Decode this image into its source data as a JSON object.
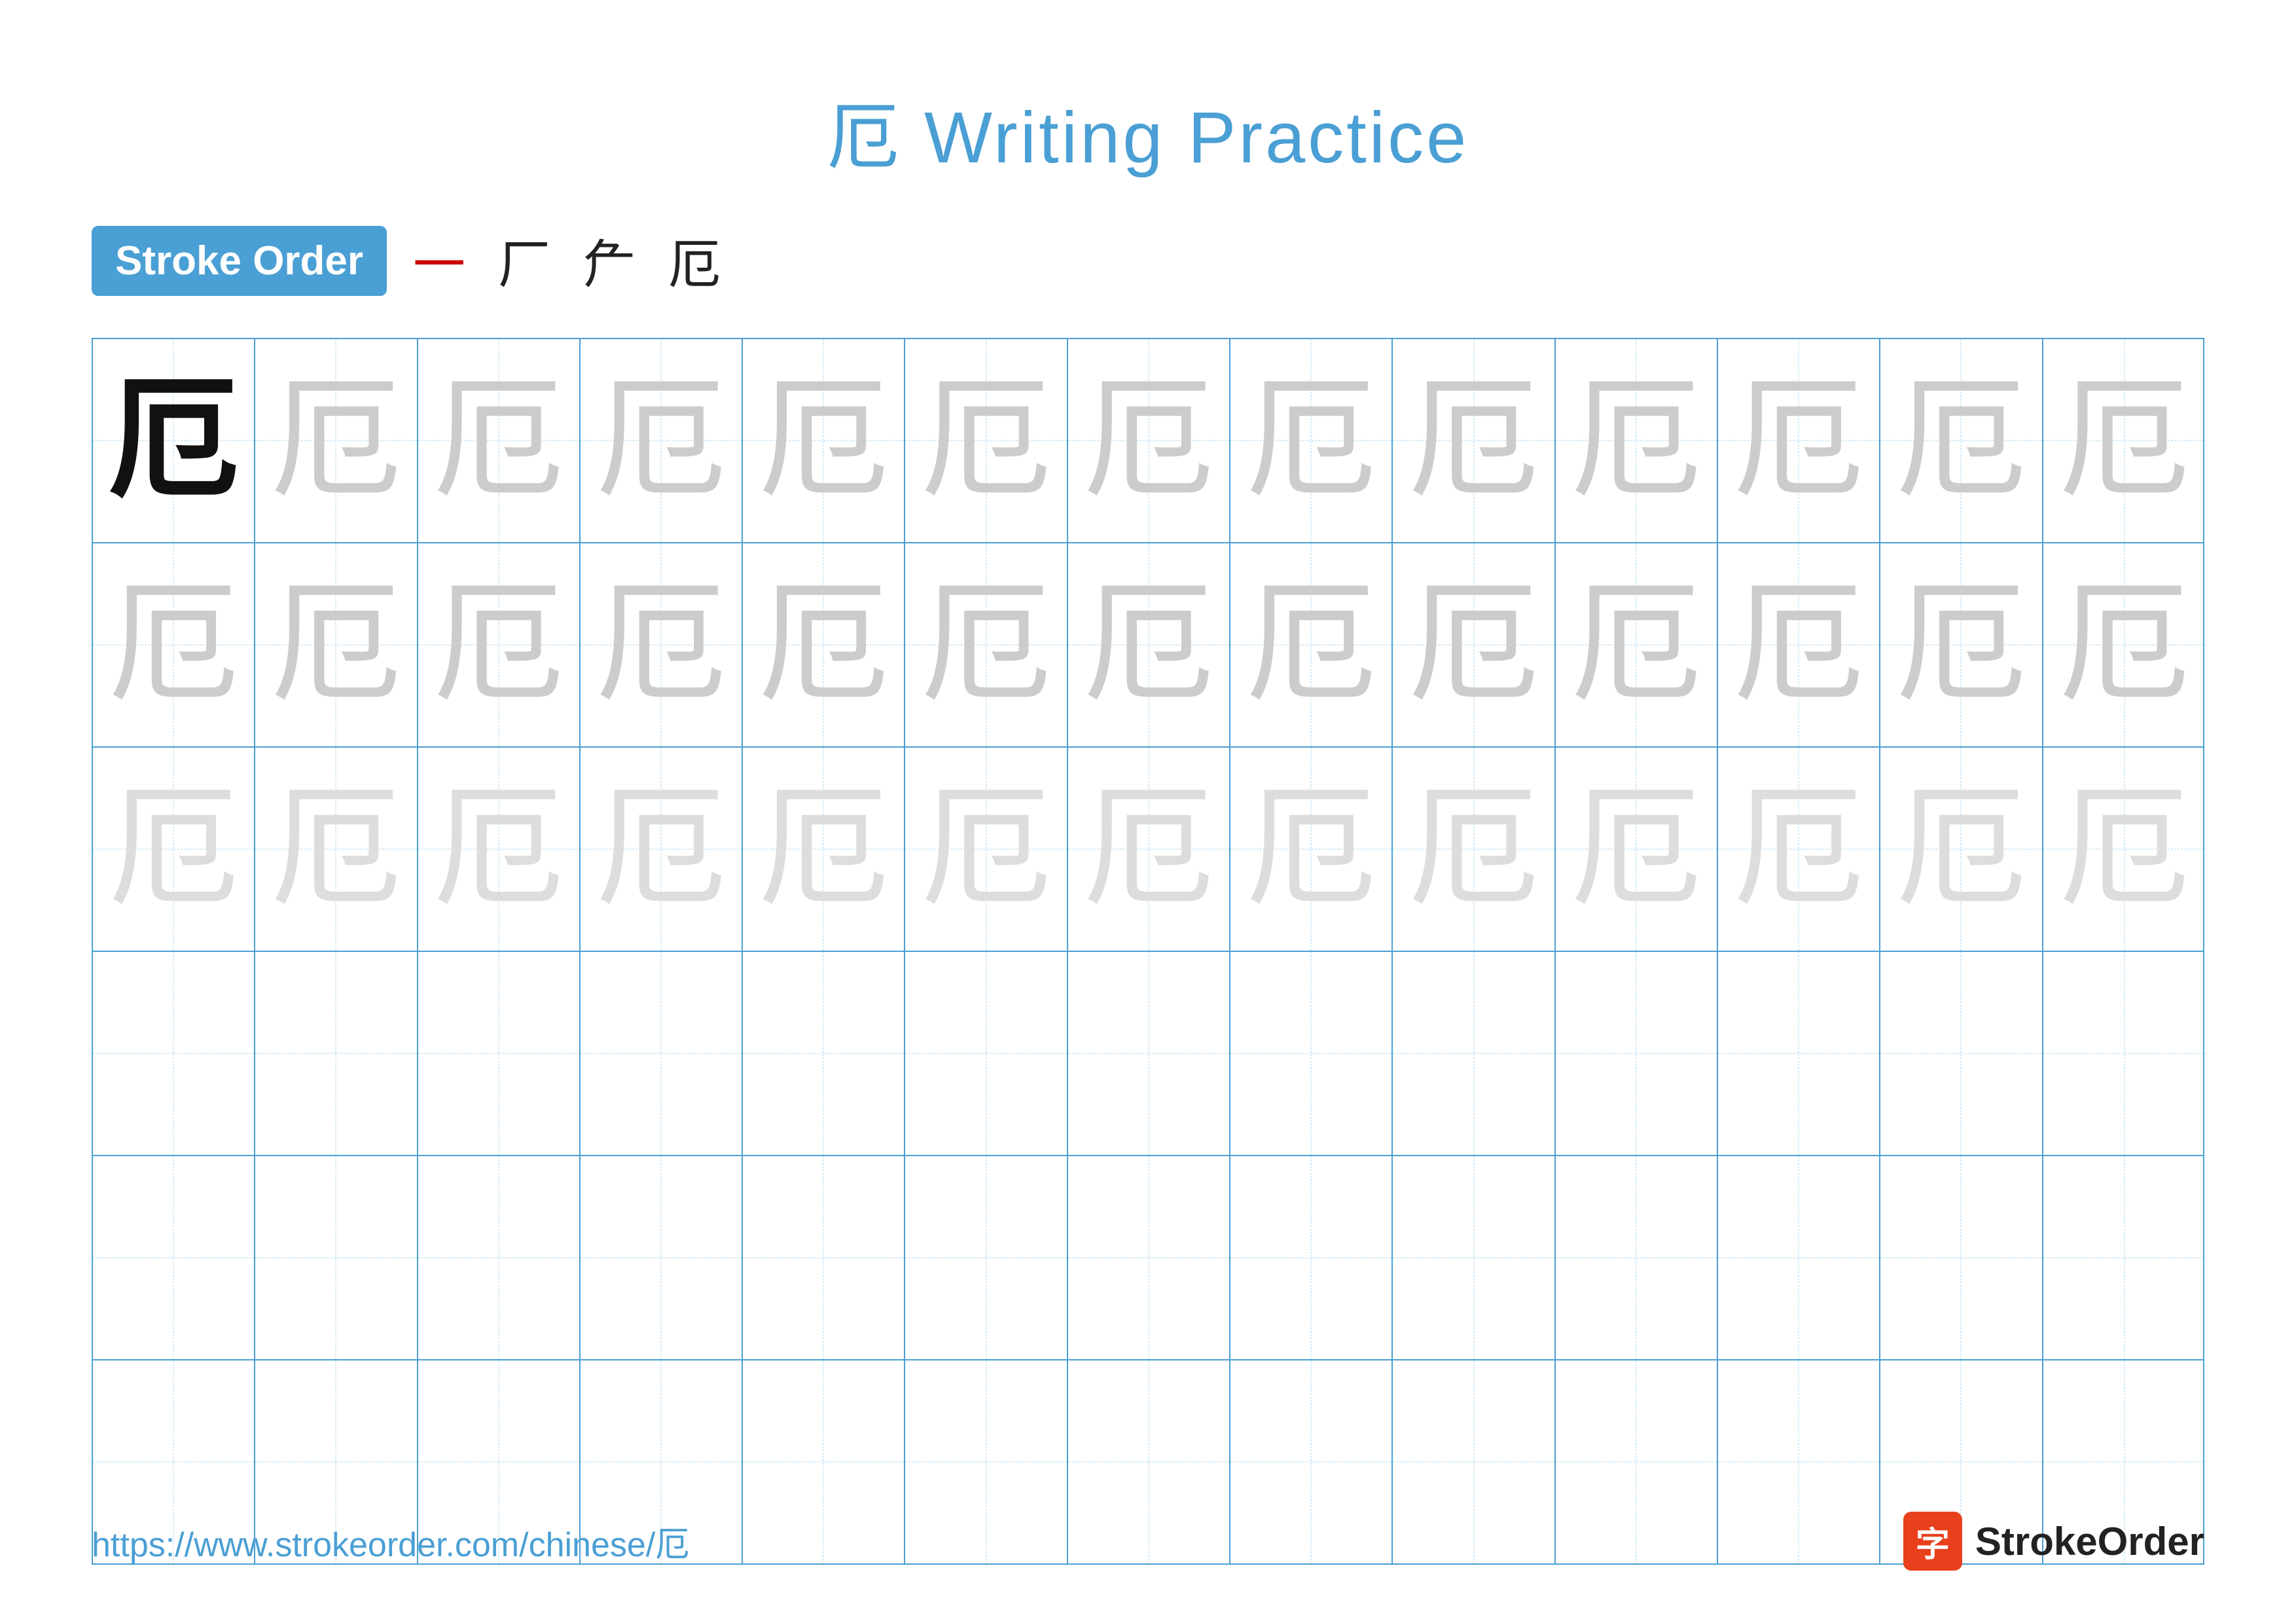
{
  "page": {
    "title": "厄 Writing Practice",
    "background": "#ffffff"
  },
  "stroke_order": {
    "label": "Stroke Order",
    "strokes": [
      "一",
      "厂",
      "厂",
      "厄"
    ],
    "stroke_colors": [
      "red",
      "black",
      "black",
      "black"
    ]
  },
  "grid": {
    "rows": 6,
    "cols": 13,
    "row_types": [
      "dark+light",
      "light",
      "lighter",
      "empty",
      "empty",
      "empty"
    ]
  },
  "character": "厄",
  "footer": {
    "url": "https://www.strokeorder.com/chinese/厄",
    "logo_text": "StrokeOrder",
    "logo_char": "字"
  }
}
